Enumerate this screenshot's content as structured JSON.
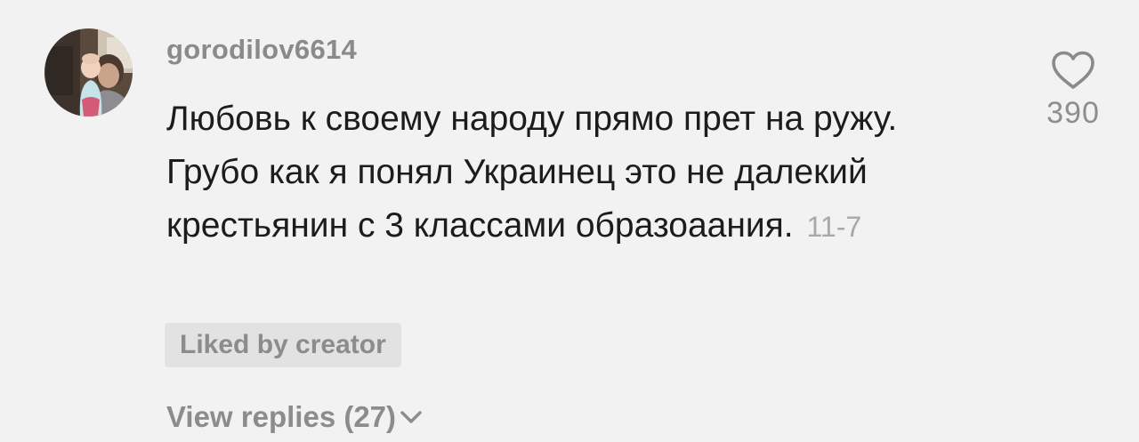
{
  "comment": {
    "username": "gorodilov6614",
    "text": "Любовь к своему народу прямо прет на ружу. Грубо как я понял Украинец это не далекий крестьянин с 3 классами образоаания.",
    "date": "11-7",
    "likes": "390",
    "liked_by_creator_label": "Liked by creator",
    "view_replies_label": "View replies (27)",
    "icons": {
      "like": "heart-outline-icon",
      "expand": "chevron-down-icon"
    }
  },
  "colors": {
    "background": "#f2f2f2",
    "text": "#1c1c1c",
    "muted": "#8c8c8c",
    "badge_bg": "#e2e2e2"
  }
}
